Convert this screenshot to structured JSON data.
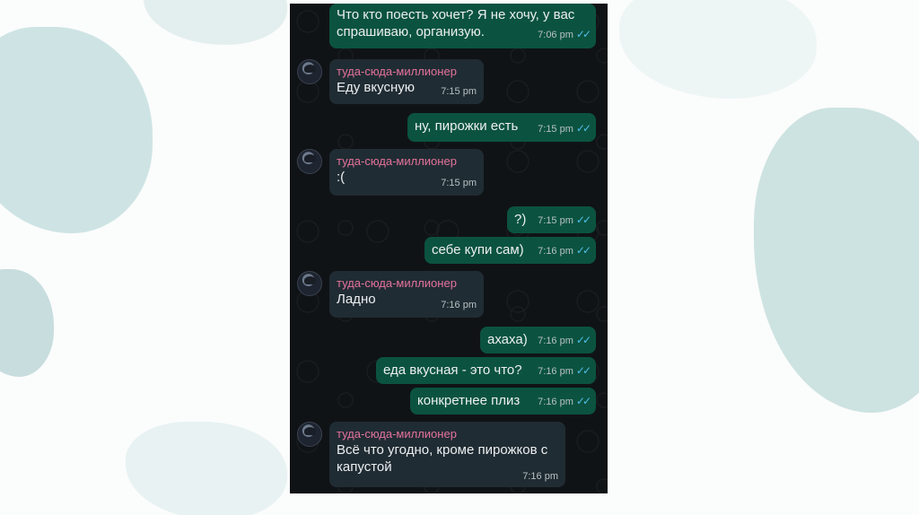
{
  "colors": {
    "outgoing": "#0b5340",
    "incoming": "#202c33",
    "sender_name": "#e5729c",
    "read_ticks": "#53bdeb"
  },
  "icons": {
    "read_receipt": "double-check-icon",
    "avatar": "user-avatar"
  },
  "messages": [
    {
      "kind": "out",
      "text": "Что кто поесть хочет? Я не хочу, у вас спрашиваю, организую.",
      "time": "7:06 pm"
    },
    {
      "kind": "in",
      "sender": "туда-сюда-миллионер",
      "text": "Еду вкусную",
      "time": "7:15 pm"
    },
    {
      "kind": "out",
      "text": "ну, пирожки есть",
      "time": "7:15 pm"
    },
    {
      "kind": "in",
      "sender": "туда-сюда-миллионер",
      "text": ":(",
      "time": "7:15 pm"
    },
    {
      "kind": "out",
      "text": "?)",
      "time": "7:15 pm"
    },
    {
      "kind": "out",
      "text": "себе купи сам)",
      "time": "7:16 pm"
    },
    {
      "kind": "in",
      "sender": "туда-сюда-миллионер",
      "text": "Ладно",
      "time": "7:16 pm"
    },
    {
      "kind": "out",
      "text": "ахаха)",
      "time": "7:16 pm"
    },
    {
      "kind": "out",
      "text": "еда вкусная - это что?",
      "time": "7:16 pm"
    },
    {
      "kind": "out",
      "text": "конкретнее плиз",
      "time": "7:16 pm"
    },
    {
      "kind": "in",
      "sender": "туда-сюда-миллионер",
      "text": "Всё что угодно, кроме пирожков с капустой",
      "time": "7:16 pm"
    }
  ]
}
